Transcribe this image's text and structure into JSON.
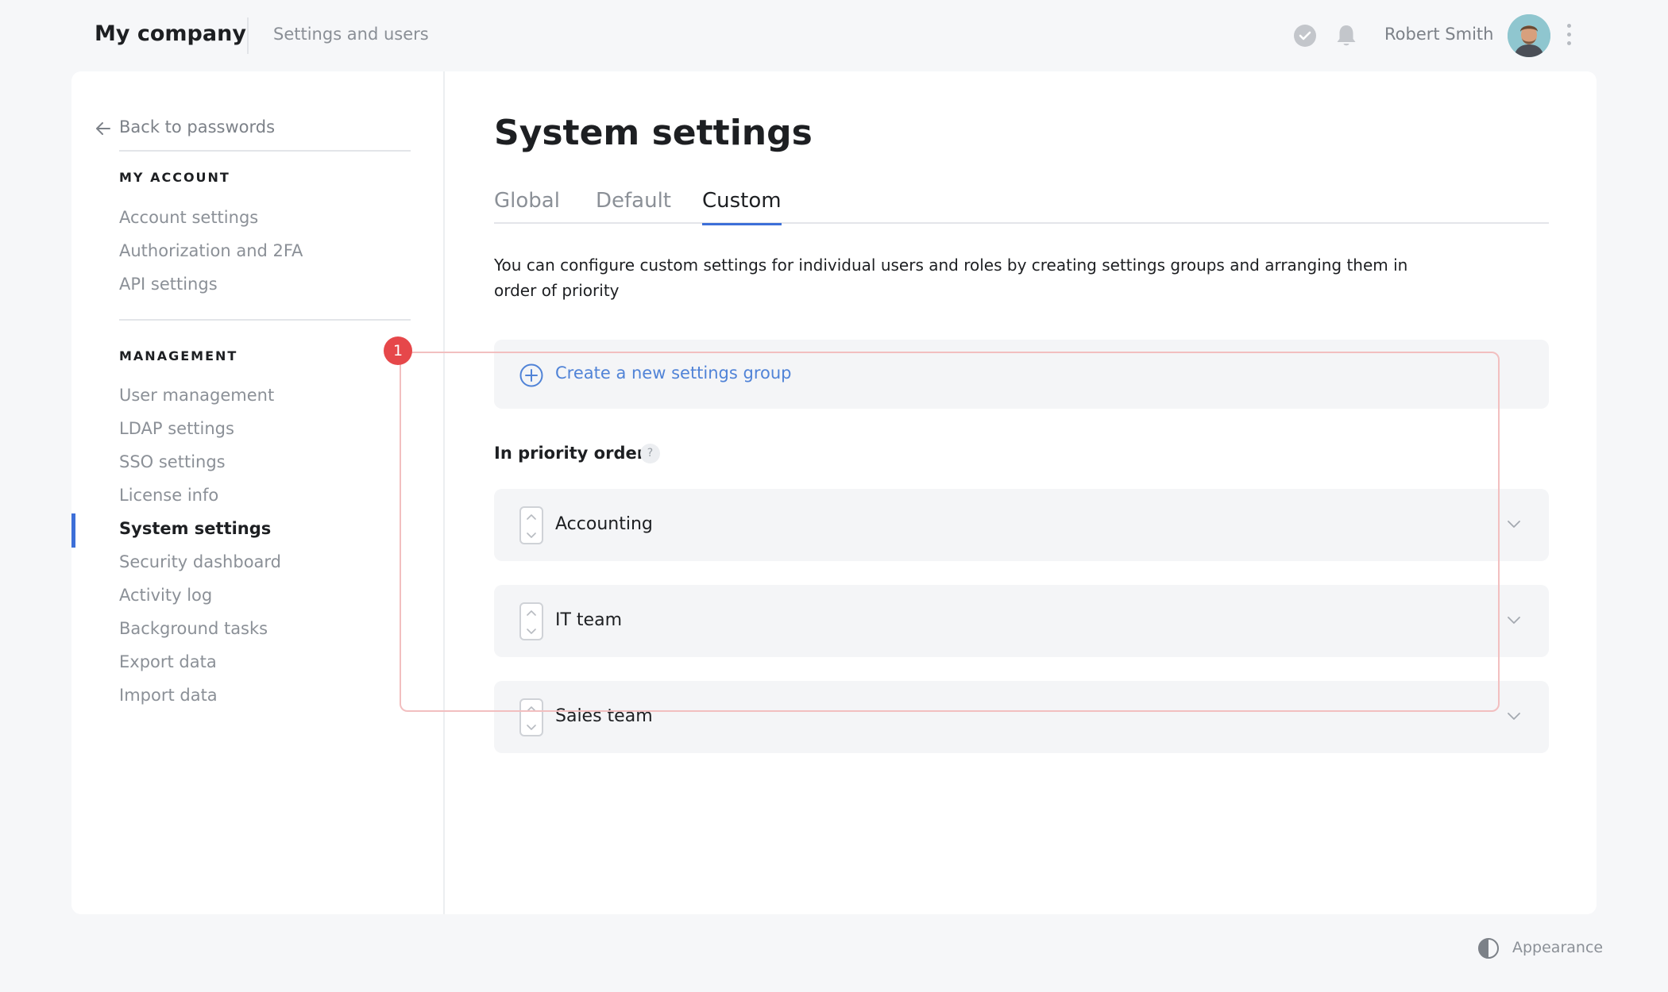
{
  "header": {
    "company": "My company",
    "subtitle": "Settings and users",
    "user_name": "Robert Smith",
    "icons": [
      "check-circle-icon",
      "bell-icon",
      "more-vertical-icon"
    ]
  },
  "sidebar": {
    "back_label": "Back to passwords",
    "sections": [
      {
        "title": "MY ACCOUNT",
        "items": [
          "Account settings",
          "Authorization and 2FA",
          "API settings"
        ]
      },
      {
        "title": "MANAGEMENT",
        "items": [
          "User management",
          "LDAP settings",
          "SSO settings",
          "License info",
          "System settings",
          "Security dashboard",
          "Activity log",
          "Background tasks",
          "Export data",
          "Import data"
        ]
      }
    ],
    "active_item": "System settings"
  },
  "main": {
    "title": "System settings",
    "tabs": [
      {
        "label": "Global",
        "active": false
      },
      {
        "label": "Default",
        "active": false
      },
      {
        "label": "Custom",
        "active": true
      }
    ],
    "description": "You can configure custom settings for individual users and roles by creating settings groups and arranging them in order of priority",
    "create_label": "Create a new settings group",
    "priority_label": "In priority order:",
    "help_glyph": "?",
    "groups": [
      "Accounting",
      "IT team",
      "Sales team"
    ]
  },
  "annotation": {
    "badge": "1"
  },
  "footer": {
    "appearance_label": "Appearance"
  },
  "colors": {
    "accent": "#3d6fd8",
    "link": "#5083d7",
    "badge": "#e6474a",
    "highlight_border": "#f2bfc0",
    "background": "#f6f7f9"
  }
}
